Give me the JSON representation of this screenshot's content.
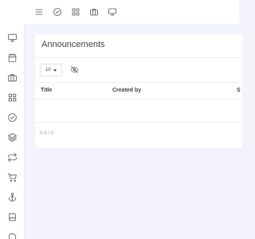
{
  "topbar": {
    "icons": [
      "menu-icon",
      "check-circle-icon",
      "grid-icon",
      "briefcase-icon",
      "monitor-icon"
    ]
  },
  "sidebar": {
    "icons": [
      "monitor-icon",
      "calendar-icon",
      "briefcase-icon",
      "grid-icon",
      "check-circle-icon",
      "layers-icon",
      "repeat-icon",
      "cart-icon",
      "anchor-icon",
      "book-icon",
      "circle-icon"
    ]
  },
  "card": {
    "title": "Announcements",
    "page_size": "10",
    "columns": [
      "Title",
      "Created by",
      "S"
    ],
    "pagination": "0-0 / 0"
  },
  "colors": {
    "background": "#f3f4fb",
    "surface": "#ffffff",
    "accent": "#8a2f43"
  }
}
